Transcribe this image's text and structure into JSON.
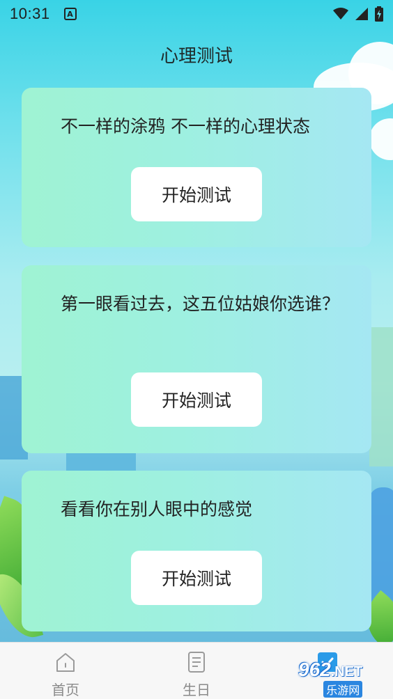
{
  "status_bar": {
    "time": "10:31",
    "notification_letter": "A",
    "icons": [
      "wifi-icon",
      "signal-icon",
      "battery-charging-icon"
    ]
  },
  "header": {
    "title": "心理测试"
  },
  "cards": [
    {
      "text": "不一样的涂鸦 不一样的心理状态",
      "button": "开始测试"
    },
    {
      "text": "第一眼看过去，这五位姑娘你选谁？",
      "button": "开始测试"
    },
    {
      "text": "看看你在别人眼中的感觉",
      "button": "开始测试"
    }
  ],
  "bottom_nav": {
    "items": [
      {
        "label": "首页",
        "icon": "home-icon",
        "active": false
      },
      {
        "label": "生日",
        "icon": "document-icon",
        "active": false
      },
      {
        "label": "",
        "icon": "check-box-icon",
        "active": true
      }
    ]
  },
  "watermark": {
    "logo": "962",
    "domain": ".NET",
    "sub": "乐游网"
  },
  "colors": {
    "card_start": "#9ff3d3",
    "card_end": "#a5e7f3",
    "button_bg": "#ffffff",
    "active_tab": "#2b9be8"
  }
}
